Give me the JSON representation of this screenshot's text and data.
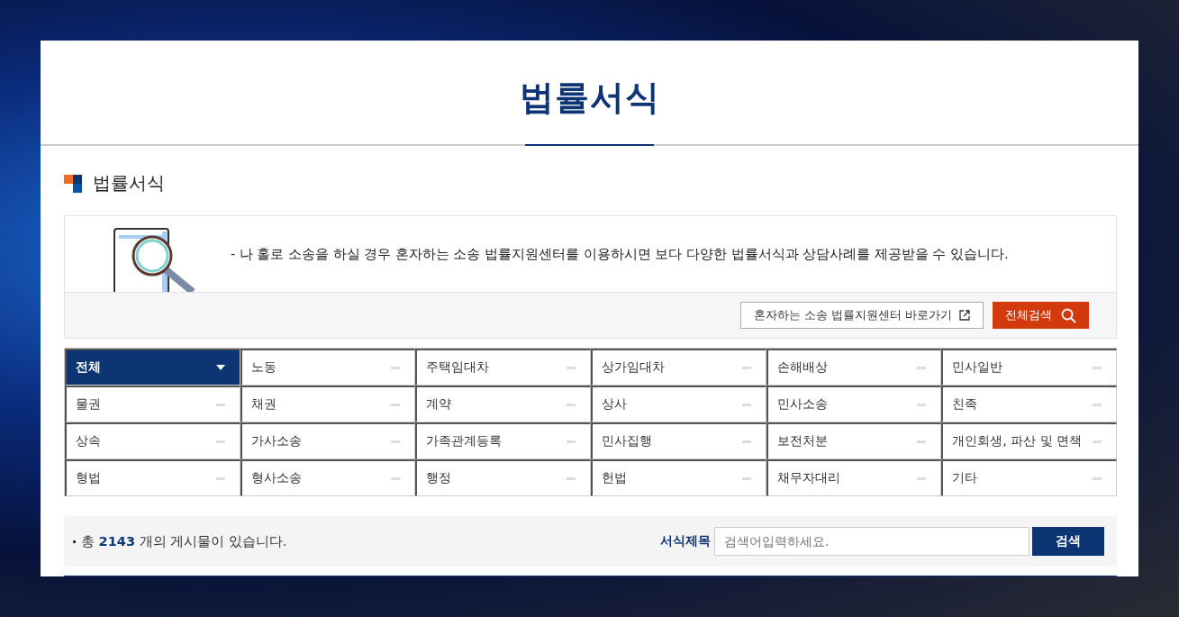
{
  "page_title": "법률서식",
  "section_title": "법률서식",
  "notice": {
    "text": "- 나 홀로 소송을 하실 경우 혼자하는 소송 법률지원센터를 이용하시면 보다 다양한 법률서식과 상담사례를 제공받을 수 있습니다.",
    "link_button": "혼자하는 소송 법률지원센터 바로가기",
    "search_all_button": "전체검색"
  },
  "categories": [
    {
      "label": "전체",
      "selected": true
    },
    {
      "label": "노동",
      "selected": false
    },
    {
      "label": "주택임대차",
      "selected": false
    },
    {
      "label": "상가임대차",
      "selected": false
    },
    {
      "label": "손해배상",
      "selected": false
    },
    {
      "label": "민사일반",
      "selected": false
    },
    {
      "label": "물권",
      "selected": false
    },
    {
      "label": "채권",
      "selected": false
    },
    {
      "label": "계약",
      "selected": false
    },
    {
      "label": "상사",
      "selected": false
    },
    {
      "label": "민사소송",
      "selected": false
    },
    {
      "label": "친족",
      "selected": false
    },
    {
      "label": "상속",
      "selected": false
    },
    {
      "label": "가사소송",
      "selected": false
    },
    {
      "label": "가족관계등록",
      "selected": false
    },
    {
      "label": "민사집행",
      "selected": false
    },
    {
      "label": "보전처분",
      "selected": false
    },
    {
      "label": "개인회생, 파산 및 면책",
      "selected": false
    },
    {
      "label": "형법",
      "selected": false
    },
    {
      "label": "형사소송",
      "selected": false
    },
    {
      "label": "행정",
      "selected": false
    },
    {
      "label": "헌법",
      "selected": false
    },
    {
      "label": "채무자대리",
      "selected": false
    },
    {
      "label": "기타",
      "selected": false
    }
  ],
  "search_bar": {
    "count_text": "총 **2143** 개의 게시물이 있습니다.",
    "field_label": "서식제목",
    "placeholder": "검색어입력하세요.",
    "button": "검색"
  }
}
